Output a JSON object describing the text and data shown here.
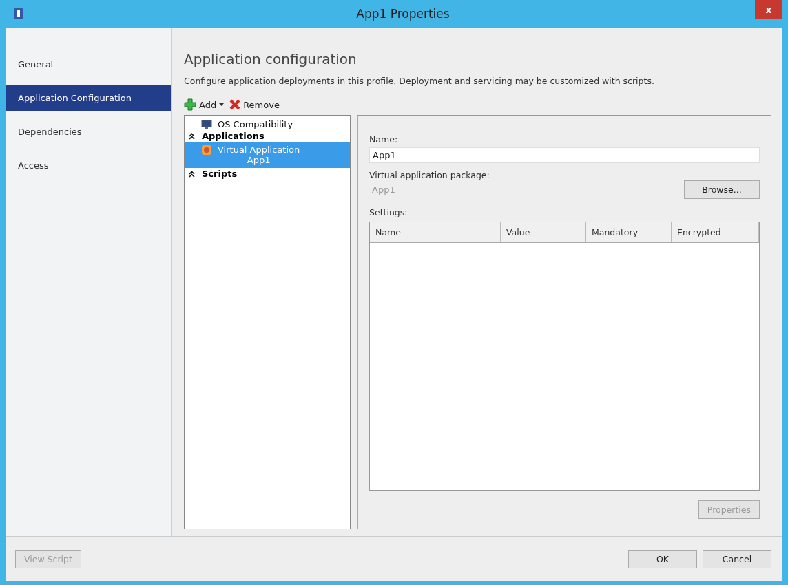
{
  "window": {
    "title": "App1 Properties",
    "close": "x"
  },
  "nav": [
    {
      "label": "General",
      "selected": false
    },
    {
      "label": "Application Configuration",
      "selected": true
    },
    {
      "label": "Dependencies",
      "selected": false
    },
    {
      "label": "Access",
      "selected": false
    }
  ],
  "heading": "Application configuration",
  "description": "Configure application deployments in this profile. Deployment and servicing may be customized with scripts.",
  "toolbar": {
    "add": "Add",
    "remove": "Remove"
  },
  "tree": [
    {
      "kind": "item",
      "label": "OS Compatibility",
      "selected": false
    },
    {
      "kind": "group",
      "label": "Applications",
      "expanded": true
    },
    {
      "kind": "app",
      "label": "Virtual Application",
      "sublabel": "App1",
      "selected": true
    },
    {
      "kind": "group",
      "label": "Scripts",
      "expanded": true
    }
  ],
  "name_field": {
    "label": "Name:",
    "value": "App1"
  },
  "package_field": {
    "label": "Virtual application package:",
    "value": "App1",
    "disabled": true
  },
  "browse_button": {
    "label": "Browse...",
    "disabled": false
  },
  "settings": {
    "label": "Settings:",
    "columns": [
      "Name",
      "Value",
      "Mandatory",
      "Encrypted"
    ]
  },
  "properties_button": {
    "label": "Properties",
    "disabled": true
  },
  "footer": [
    {
      "label": "View Script",
      "disabled": true
    },
    {
      "label": "OK",
      "disabled": false
    },
    {
      "label": "Cancel",
      "disabled": false
    }
  ]
}
